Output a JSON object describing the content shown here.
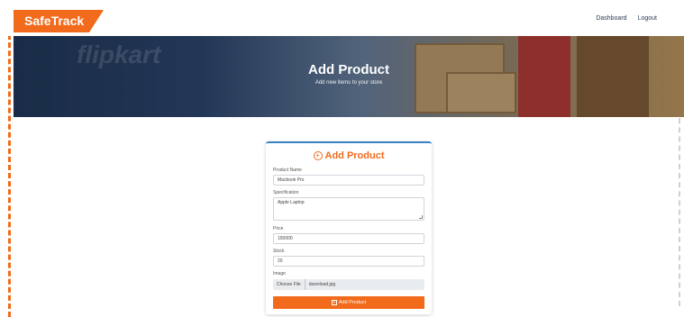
{
  "navbar": {
    "brand": "SafeTrack",
    "links": [
      "Dashboard",
      "Logout"
    ]
  },
  "hero": {
    "title": "Add Product",
    "subtitle": "Add new items to your store",
    "watermark": "flipkart"
  },
  "form": {
    "title": "Add Product",
    "icon": "plus-circle-icon",
    "fields": {
      "product_name": {
        "label": "Product Name",
        "value": "Macbook Pro"
      },
      "specification": {
        "label": "Specification",
        "value": "Apple Laptop"
      },
      "price": {
        "label": "Price",
        "value": "150000"
      },
      "stock": {
        "label": "Stock",
        "value": "20"
      },
      "image": {
        "label": "Image",
        "button": "Choose File",
        "filename": "download.jpg"
      }
    },
    "submit_label": "Add Product"
  },
  "colors": {
    "accent": "#f26a1b",
    "card_top_border": "#3b82c4"
  }
}
